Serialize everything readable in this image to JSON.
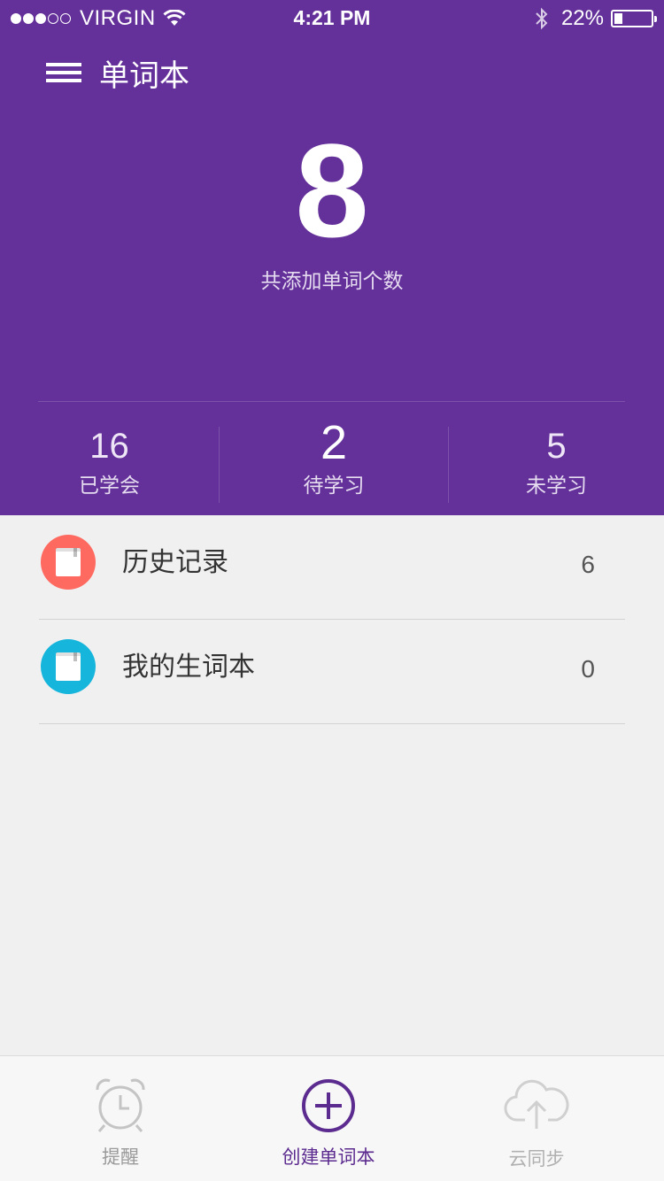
{
  "status_bar": {
    "carrier": "VIRGIN",
    "time": "4:21 PM",
    "battery_text": "22%",
    "battery_level": 0.22
  },
  "nav": {
    "title": "单词本"
  },
  "summary": {
    "total_count": "8",
    "total_label": "共添加单词个数"
  },
  "stats": [
    {
      "value": "16",
      "label": "已学会"
    },
    {
      "value": "2",
      "label": "待学习"
    },
    {
      "value": "5",
      "label": "未学习"
    }
  ],
  "list": [
    {
      "label": "历史记录",
      "count": "6",
      "icon": "book-icon",
      "color": "#ff6a60"
    },
    {
      "label": "我的生词本",
      "count": "0",
      "icon": "book-icon",
      "color": "#15b5dc"
    }
  ],
  "tabs": [
    {
      "label": "提醒",
      "icon": "alarm-clock-icon"
    },
    {
      "label": "创建单词本",
      "icon": "plus-circle-icon"
    },
    {
      "label": "云同步",
      "icon": "cloud-upload-icon"
    }
  ],
  "colors": {
    "header_bg": "#64309a",
    "accent": "#5c2b8f",
    "inactive_tab": "#bdbdbd"
  }
}
